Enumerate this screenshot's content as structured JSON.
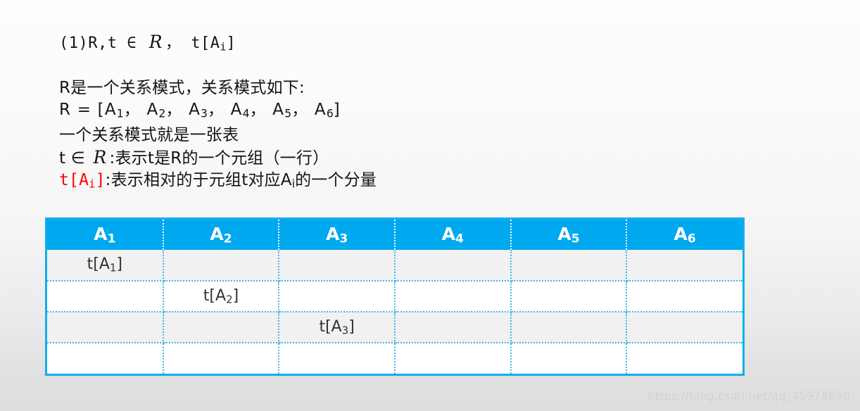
{
  "slide": {
    "heading_line": {
      "prefix": "(1)R,t ∈ ",
      "math_symbol": "R",
      "suffix": "，  t[A",
      "sub": "i",
      "tail": "]"
    },
    "paragraph": {
      "line_1": "R是一个关系模式，关系模式如下:",
      "line_2_prefix": "R = [A",
      "line_2_items": [
        "1",
        "2",
        "3",
        "4",
        "5",
        "6"
      ],
      "line_2_sep": "，  A",
      "line_2_suffix": "]",
      "line_3": "一个关系模式就是一张表",
      "line_4_prefix": "t ∈ ",
      "line_4_math": "R",
      "line_4_suffix": ":表示t是R的一个元组（一行）",
      "line_5_red_prefix": "t[A",
      "line_5_red_sub": "i",
      "line_5_red_suffix": "]",
      "line_5_black_a": ":表示相对的于元组t对应A",
      "line_5_black_sub": "i",
      "line_5_black_b": "的一个分量"
    },
    "table": {
      "headers": [
        {
          "base": "A",
          "sub": "1"
        },
        {
          "base": "A",
          "sub": "2"
        },
        {
          "base": "A",
          "sub": "3"
        },
        {
          "base": "A",
          "sub": "4"
        },
        {
          "base": "A",
          "sub": "5"
        },
        {
          "base": "A",
          "sub": "6"
        }
      ],
      "rows": [
        {
          "shaded": true,
          "cells": [
            {
              "base": "t[A",
              "sub": "1",
              "tail": "]"
            },
            null,
            null,
            null,
            null,
            null
          ]
        },
        {
          "shaded": false,
          "cells": [
            null,
            {
              "base": "t[A",
              "sub": "2",
              "tail": "]"
            },
            null,
            null,
            null,
            null
          ]
        },
        {
          "shaded": true,
          "cells": [
            null,
            null,
            {
              "base": "t[A",
              "sub": "3",
              "tail": "]"
            },
            null,
            null,
            null
          ]
        },
        {
          "shaded": false,
          "cells": [
            null,
            null,
            null,
            null,
            null,
            null
          ]
        }
      ]
    },
    "watermark": "https://blog.csdn.net/qq_45978890",
    "colors": {
      "header_blue": "#00A8F0",
      "border_blue": "#11AEEE",
      "dotted_blue": "#3FB8EE",
      "red_text": "#FF0000",
      "row_shade": "#F1F1F1"
    }
  }
}
